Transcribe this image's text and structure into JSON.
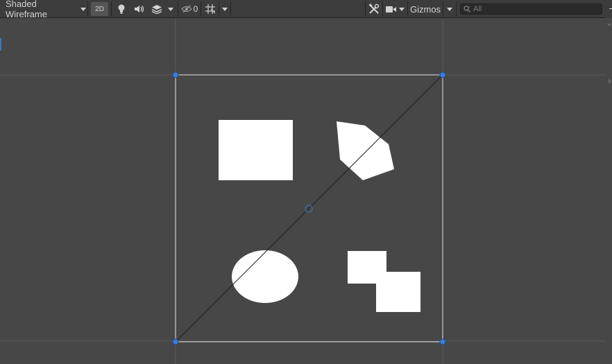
{
  "toolbar": {
    "draw_mode": "Shaded Wireframe",
    "mode_2d_label": "2D",
    "hidden_count": "0",
    "gizmos_label": "Gizmos",
    "search_placeholder": "All",
    "icons": {
      "lighting": "lightbulb-icon",
      "audio": "speaker-icon",
      "effects": "effects-layers-icon",
      "visibility": "eye-slash-icon",
      "grid": "grid-snap-icon",
      "tools": "tools-icon",
      "camera": "camera-icon",
      "search": "search-icon"
    }
  },
  "scene": {
    "background_color": "#474747",
    "shape_color": "#ffffff",
    "selection_color": "#e6e6e6",
    "handle_color": "#3b7ddd",
    "shapes": [
      {
        "kind": "square",
        "name": "white-square-sprite"
      },
      {
        "kind": "hexagon",
        "name": "white-polygon-sprite"
      },
      {
        "kind": "ellipse",
        "name": "white-circle-sprite"
      },
      {
        "kind": "steps",
        "name": "white-steps-sprite"
      }
    ]
  }
}
